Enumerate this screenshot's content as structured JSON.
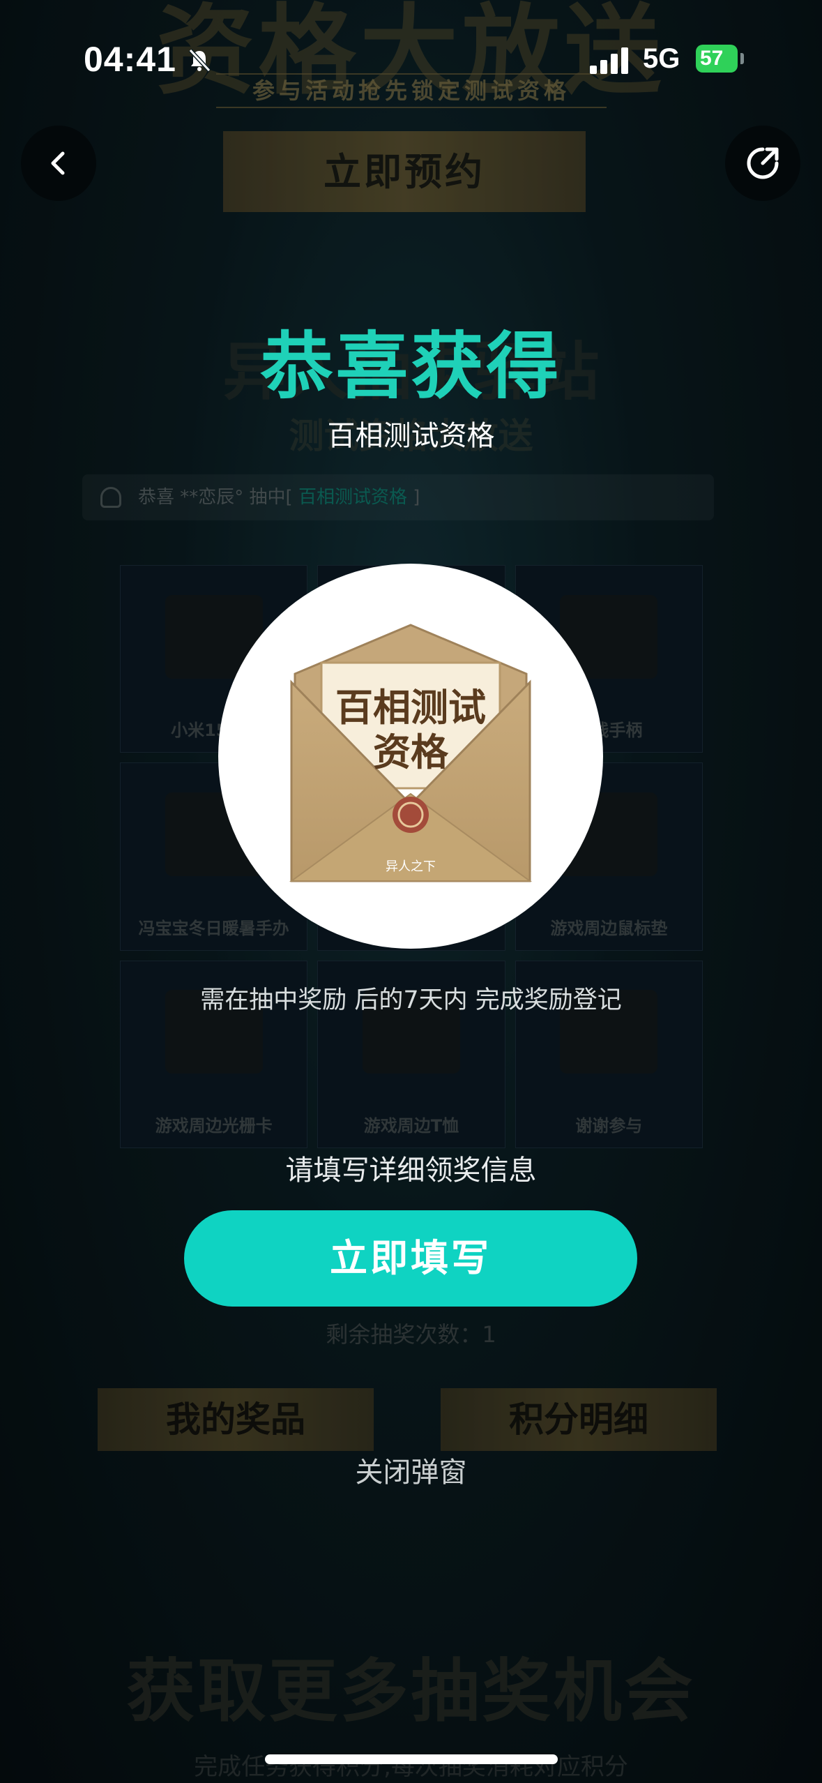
{
  "status_bar": {
    "time": "04:41",
    "network": "5G",
    "battery": "57"
  },
  "background": {
    "hero_title": "资格大放送",
    "hero_subtitle": "参与活动抢先锁定测试资格",
    "reserve_button": "立即预约",
    "event_title": "异人抽卡驿站",
    "event_subtitle": "测试资格大放送",
    "marquee": {
      "prefix": "恭喜 **恋辰° 抽中[ ",
      "prize": "百相测试资格",
      "suffix": " ]"
    },
    "prize_grid": [
      "小米15 16",
      "",
      "无线手柄",
      "冯宝宝冬日暖暑手办",
      "",
      "游戏周边鼠标垫",
      "游戏周边光栅卡",
      "游戏周边T恤",
      "谢谢参与"
    ],
    "remaining_draws": "剩余抽奖次数：1",
    "my_prizes_button": "我的奖品",
    "points_detail_button": "积分明细",
    "more_chances_title": "获取更多抽奖机会",
    "more_chances_subtitle": "完成任务获得积分,每次抽奖消耗对应积分"
  },
  "modal": {
    "title": "恭喜获得",
    "prize_name": "百相测试资格",
    "prize_card_text_line1": "百相测试",
    "prize_card_text_line2": "资格",
    "prize_card_brand": "异人之下",
    "deadline_note": "需在抽中奖励 后的7天内 完成奖励登记",
    "fill_info_prompt": "请填写详细领奖信息",
    "fill_button": "立即填写",
    "close_link": "关闭弹窗"
  },
  "colors": {
    "accent": "#0fd3c2",
    "title": "#1fd1b8",
    "battery": "#2fd159"
  },
  "icons": {
    "back": "chevron-left-icon",
    "share": "share-icon",
    "mute": "bell-slash-icon"
  }
}
